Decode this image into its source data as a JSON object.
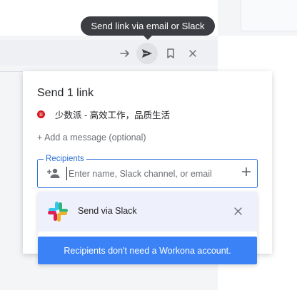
{
  "tooltip": {
    "text": "Send link via email or Slack"
  },
  "toolbar": {
    "icons": [
      "arrow-right-icon",
      "send-icon",
      "bookmark-icon",
      "close-icon"
    ]
  },
  "popup": {
    "title": "Send 1 link",
    "link": {
      "favicon_text": "π",
      "title": "少数派 - 高效工作，品质生活"
    },
    "add_message": "+ Add a message (optional)",
    "recipients": {
      "label": "Recipients",
      "placeholder": "Enter name, Slack channel, or email",
      "value": ""
    }
  },
  "dropdown": {
    "slack_option": "Send via Slack",
    "banner": "Recipients don't need a Workona account."
  },
  "colors": {
    "accent": "#2a6fd6",
    "banner": "#3b82f6",
    "tooltip_bg": "#3a3d41",
    "favicon": "#d71920",
    "selected_row": "#eef1fb"
  }
}
